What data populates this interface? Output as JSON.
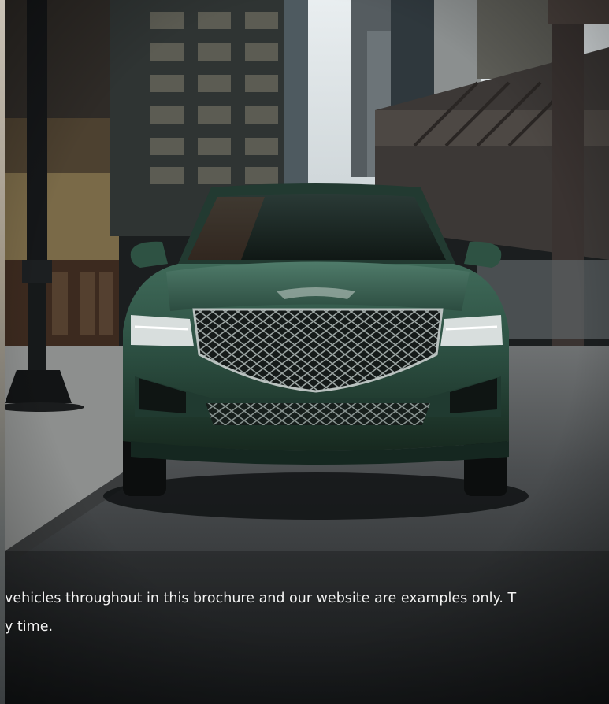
{
  "caption": {
    "line1": "vehicles throughout in this brochure and our website are examples only. T",
    "line2": "y time."
  }
}
